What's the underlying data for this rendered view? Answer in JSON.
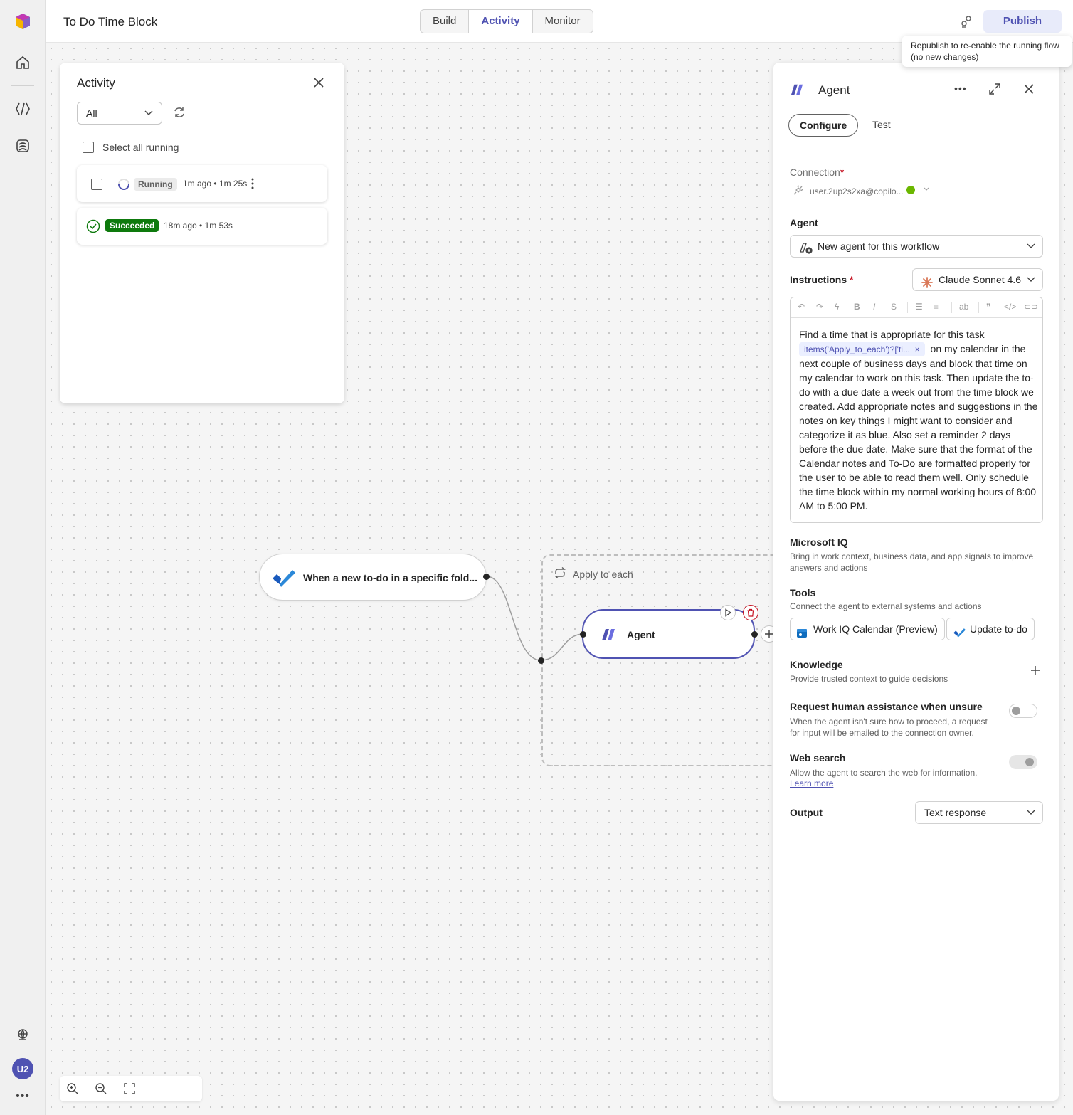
{
  "header": {
    "title": "To Do Time Block",
    "tabs": [
      "Build",
      "Activity",
      "Monitor"
    ],
    "active_tab": "Activity",
    "publish_label": "Publish",
    "tooltip": "Republish to re-enable the running flow (no new changes)"
  },
  "rail": {
    "avatar_initials": "U2",
    "icons": [
      "app-logo-icon",
      "home-icon",
      "flows-icon",
      "agents-icon",
      "globe-icon",
      "more-icon"
    ]
  },
  "activity": {
    "title": "Activity",
    "filter_value": "All",
    "select_all_label": "Select all running",
    "runs": [
      {
        "status": "Running",
        "meta": "1m ago • 1m 25s"
      },
      {
        "status": "Succeeded",
        "meta": "18m ago • 1m 53s"
      }
    ]
  },
  "flow": {
    "trigger_label": "When a new to-do in a specific fold...",
    "loop_label": "Apply to each",
    "agent_node_label": "Agent"
  },
  "panel": {
    "title": "Agent",
    "tabs": [
      "Configure",
      "Test"
    ],
    "connection_label": "Connection",
    "connection_value": "user.2up2s2xa@copilo...",
    "agent_label": "Agent",
    "agent_value": "New agent for this workflow",
    "instructions_label": "Instructions",
    "model_value": "Claude Sonnet 4.6",
    "instructions_before": "Find a time that is appropriate for this task",
    "instructions_token": "items('Apply_to_each')?['ti...",
    "instructions_after": "on my calendar in the next couple of business days and block that time on my calendar to work on this task. Then update the to-do with a due date a week out from the time block we created. Add appropriate notes and suggestions in the notes on key things I might want to consider and categorize it as blue. Also set a reminder 2 days before the due date. Make sure that the format of the Calendar notes and To-Do are formatted properly for the user to be able to read them well. Only schedule the time block within my normal working hours of 8:00 AM to 5:00 PM.",
    "iq_label": "Microsoft IQ",
    "iq_desc": "Bring in work context, business data, and app signals to improve answers and actions",
    "tools_label": "Tools",
    "tools_desc": "Connect the agent to external systems and actions",
    "tools": [
      "Work IQ Calendar (Preview)",
      "Update to-do"
    ],
    "knowledge_label": "Knowledge",
    "knowledge_desc": "Provide trusted context to guide decisions",
    "human_label": "Request human assistance when unsure",
    "human_desc": "When the agent isn't sure how to proceed, a request for input will be emailed to the connection owner.",
    "human_enabled": false,
    "web_label": "Web search",
    "web_desc": "Allow the agent to search the web for information.",
    "web_link": "Learn more",
    "web_enabled": true,
    "output_label": "Output",
    "output_value": "Text response"
  },
  "colors": {
    "accent": "#4f52b2",
    "success": "#0e7a0d",
    "required": "#c50f1f"
  }
}
